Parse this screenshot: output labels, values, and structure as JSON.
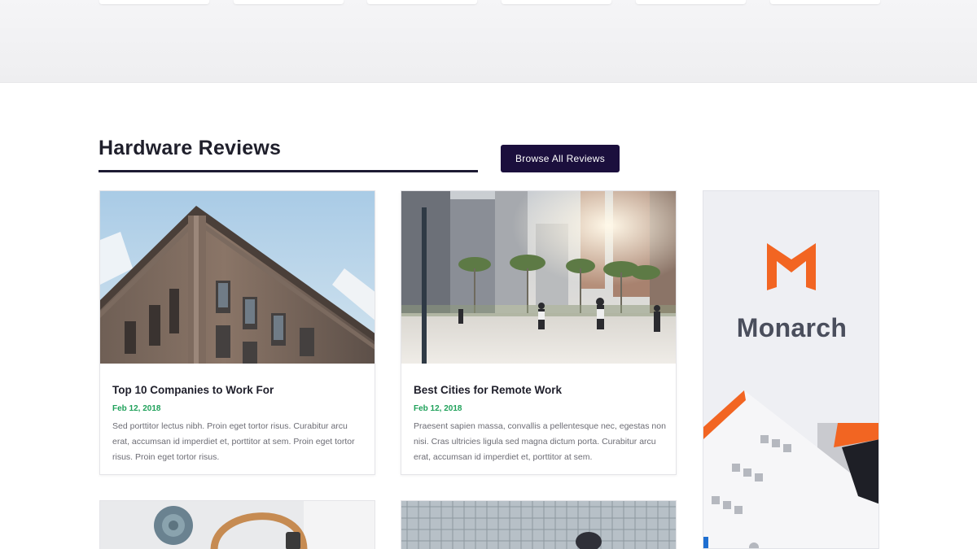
{
  "section": {
    "title": "Hardware Reviews",
    "browse_label": "Browse All Reviews"
  },
  "articles": [
    {
      "title": "Top 10 Companies to Work For",
      "date": "Feb 12, 2018",
      "excerpt": "Sed porttitor lectus nibh. Proin eget tortor risus. Curabitur arcu erat, accumsan id imperdiet et, porttitor at sem. Proin eget tortor risus. Proin eget tortor risus."
    },
    {
      "title": "Best Cities for Remote Work",
      "date": "Feb 12, 2018",
      "excerpt": "Praesent sapien massa, convallis a pellentesque nec, egestas non nisi. Cras ultricies ligula sed magna dictum porta. Curabitur arcu erat, accumsan id imperdiet et, porttitor at sem."
    }
  ],
  "ad": {
    "brand": "Monarch",
    "accent_color": "#f26522"
  },
  "colors": {
    "primary_button": "#1b0f3d",
    "date_green": "#1fa15a"
  }
}
